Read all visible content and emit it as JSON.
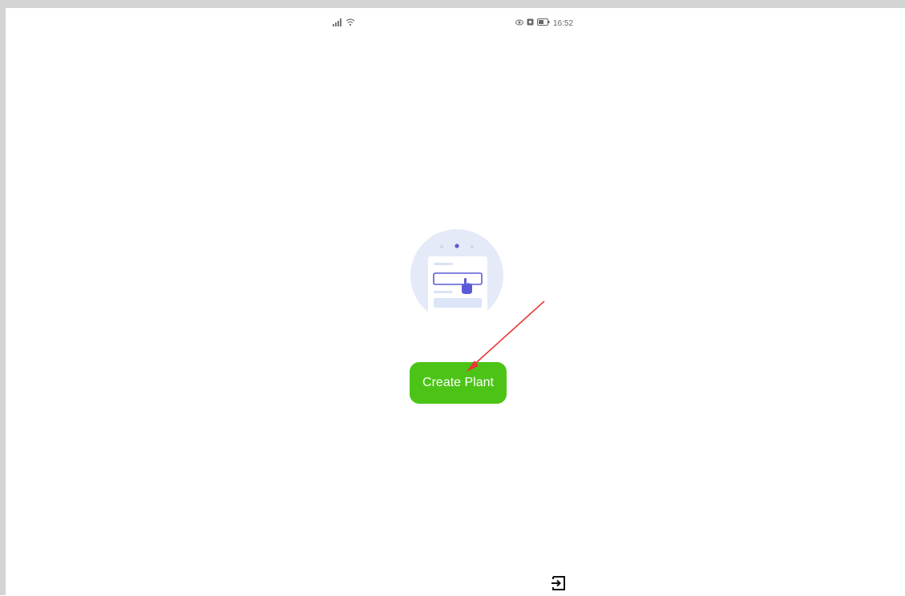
{
  "status_bar": {
    "left_icons": [
      "signal-icon",
      "wifi-icon"
    ],
    "right_icons": [
      "eye-icon",
      "notification-icon",
      "battery-icon"
    ],
    "time": "16:52"
  },
  "main": {
    "illustration": "form-tap-illustration",
    "create_button_label": "Create Plant"
  },
  "annotation": {
    "arrow_color": "#e53935"
  },
  "footer": {
    "icon": "exit-icon"
  },
  "colors": {
    "accent_green": "#4cc417",
    "illustration_bg": "#e3e9f9",
    "illustration_accent": "#5a5bd6"
  }
}
